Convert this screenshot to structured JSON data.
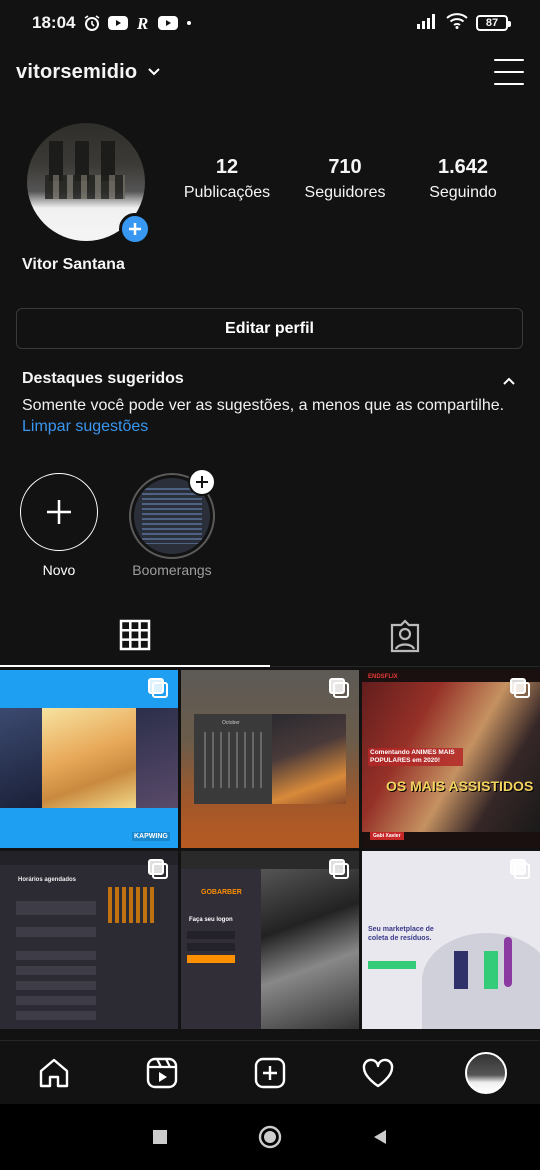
{
  "status_bar": {
    "time": "18:04",
    "battery": "87"
  },
  "header": {
    "username": "vitorsemidio"
  },
  "profile": {
    "full_name": "Vitor Santana",
    "stats": [
      {
        "value": "12",
        "label": "Publicações"
      },
      {
        "value": "710",
        "label": "Seguidores"
      },
      {
        "value": "1.642",
        "label": "Seguindo"
      }
    ],
    "edit_button": "Editar perfil"
  },
  "highlights": {
    "title": "Destaques sugeridos",
    "description": "Somente você pode ver as sugestões, a menos que as compartilhe.",
    "clear_link": "Limpar sugestões",
    "items": [
      {
        "label": "Novo"
      },
      {
        "label": "Boomerangs"
      }
    ]
  },
  "posts": {
    "cells": [
      {
        "badge": "KAPWING"
      },
      {
        "calendar_title": "October"
      },
      {
        "headline_1": "Comentando ANIMES MAIS POPULARES em 2020!",
        "headline_2": "OS MAIS ASSISTIDOS",
        "brand": "ENDSFLIX",
        "name_tag": "Gabi Xavier"
      },
      {
        "title": "Horários agendados"
      },
      {
        "brand": "GOBARBER",
        "heading": "Faça seu logon"
      },
      {
        "heading": "Seu marketplace de coleta de resíduos."
      }
    ]
  },
  "colors": {
    "accent": "#3897f0",
    "background": "#121212"
  }
}
